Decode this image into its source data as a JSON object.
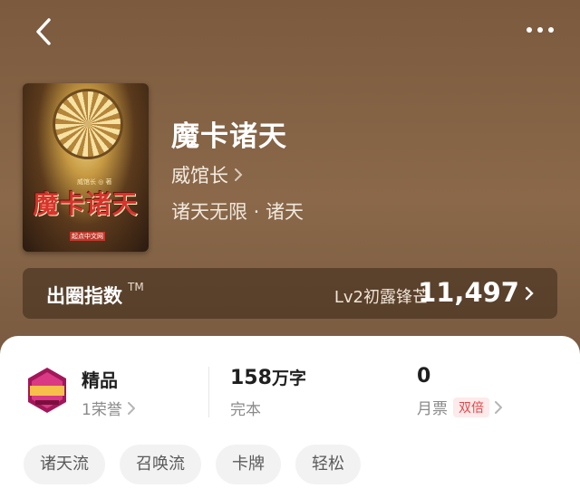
{
  "nav": {
    "back_icon": "chevron-left-icon",
    "more_icon": "more-dots-icon"
  },
  "book": {
    "title": "魔卡诸天",
    "author": "威馆长",
    "genre": "诸天无限 · 诸天",
    "cover": {
      "title": "魔卡诸天",
      "author": "威馆长 ◎ 著",
      "publisher": "起点中文网"
    }
  },
  "index": {
    "label": "出圈指数",
    "trademark": "TM",
    "level": "Lv2初露锋芒",
    "value": "11,497"
  },
  "stats": {
    "honor": {
      "title": "精品",
      "sub": "1荣誉"
    },
    "words": {
      "value": "158",
      "unit": "万字",
      "status": "完本"
    },
    "ticket": {
      "value": "0",
      "label": "月票",
      "tag": "双倍"
    }
  },
  "tags": [
    "诸天流",
    "召唤流",
    "卡牌",
    "轻松"
  ],
  "colors": {
    "accent_red": "#e2474b",
    "header_brown": "#7c5a3e",
    "sheet_bg": "#ffffff"
  }
}
